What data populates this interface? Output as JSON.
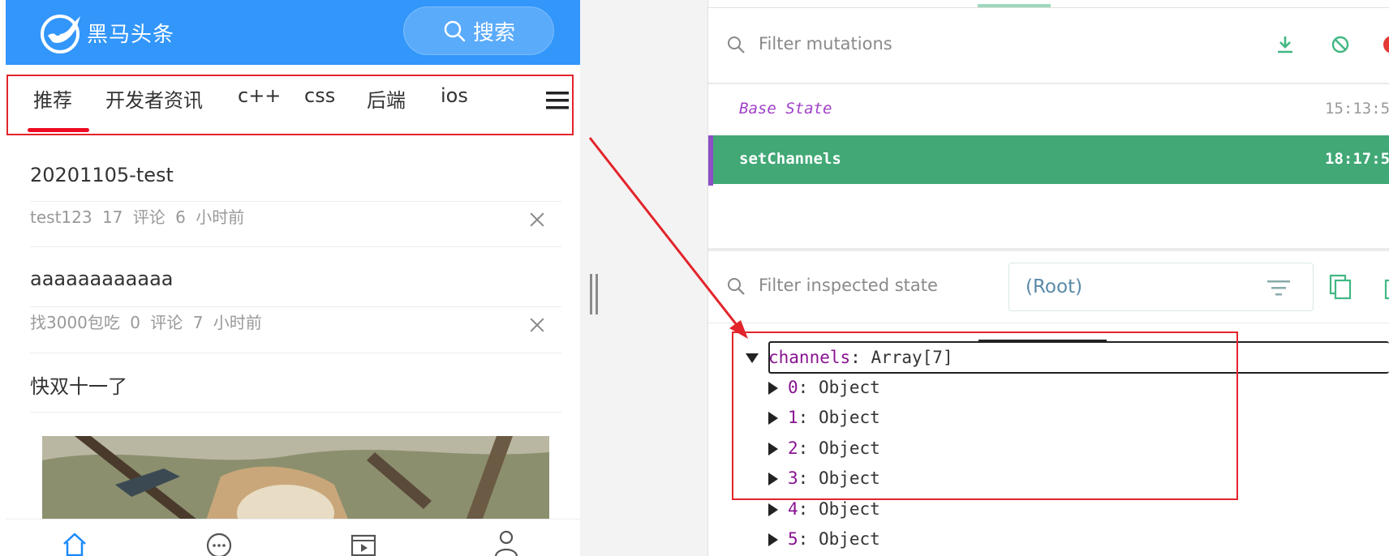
{
  "app": {
    "brand": "黑马头条",
    "search_label": "搜索",
    "channels": [
      "推荐",
      "开发者资讯",
      "c++",
      "css",
      "后端",
      "ios"
    ],
    "articles": [
      {
        "title": "20201105-test",
        "author": "test123",
        "comments": "17 评论",
        "time": "6 小时前"
      },
      {
        "title": "aaaaaaaaaaaa",
        "author": "找3000包吃",
        "comments": "0 评论",
        "time": "7 小时前"
      },
      {
        "title": "快双十一了"
      }
    ],
    "tabbar": [
      "home-icon",
      "chat-icon",
      "video-icon",
      "profile-icon"
    ]
  },
  "devtools": {
    "filter_mutations_placeholder": "Filter mutations",
    "mutations": [
      {
        "name": "Base State",
        "time": "15:13:5"
      },
      {
        "name": "setChannels",
        "time": "18:17:5"
      }
    ],
    "filter_state_placeholder": "Filter inspected state",
    "root_label": "(Root)",
    "state_tree": {
      "root_key": "channels",
      "root_value": "Array[7]",
      "children": [
        {
          "key": "0",
          "value": "Object"
        },
        {
          "key": "1",
          "value": "Object"
        },
        {
          "key": "2",
          "value": "Object"
        },
        {
          "key": "3",
          "value": "Object"
        },
        {
          "key": "4",
          "value": "Object"
        },
        {
          "key": "5",
          "value": "Object"
        }
      ]
    }
  },
  "colors": {
    "app_primary": "#3296fa",
    "tab_indicator": "#ee0a24",
    "mutation_active": "#41a876",
    "highlight_red": "#e3242b"
  }
}
